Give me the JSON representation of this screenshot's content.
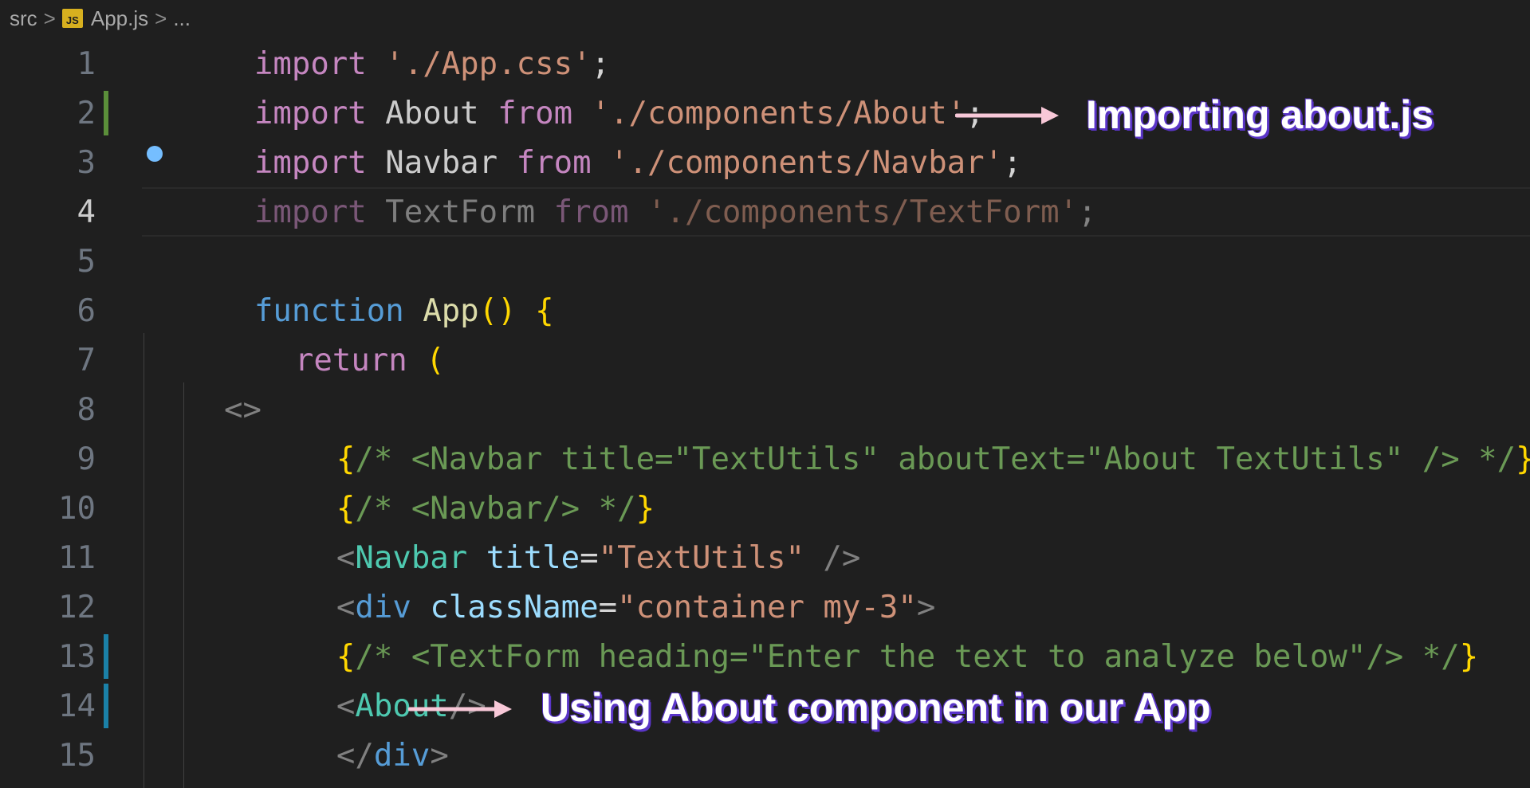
{
  "breadcrumb": {
    "folder": "src",
    "file": "App.js",
    "more": "...",
    "file_icon": "JS"
  },
  "lines": [
    {
      "n": "1"
    },
    {
      "n": "2"
    },
    {
      "n": "3"
    },
    {
      "n": "4"
    },
    {
      "n": "5"
    },
    {
      "n": "6"
    },
    {
      "n": "7"
    },
    {
      "n": "8"
    },
    {
      "n": "9"
    },
    {
      "n": "10"
    },
    {
      "n": "11"
    },
    {
      "n": "12"
    },
    {
      "n": "13"
    },
    {
      "n": "14"
    },
    {
      "n": "15"
    }
  ],
  "code": {
    "l1": {
      "kw": "import",
      "str": "'./App.css'",
      "end": ";"
    },
    "l2": {
      "kw": "import",
      "id": "About",
      "from": "from",
      "str": "'./components/About'",
      "end": ";"
    },
    "l3": {
      "kw": "import",
      "id": "Navbar",
      "from": "from",
      "str": "'./components/Navbar'",
      "end": ";"
    },
    "l4": {
      "kw": "import",
      "id": "TextForm",
      "from": "from",
      "str": "'./components/TextForm'",
      "end": ";"
    },
    "l6": {
      "kw": "function",
      "fn": "App",
      "paren": "()",
      "brace": "{"
    },
    "l7": {
      "kw": "return",
      "paren": "("
    },
    "l8": {
      "frag": "<>"
    },
    "l9": {
      "open": "{",
      "comment": "/* <Navbar title=\"TextUtils\" aboutText=\"About TextUtils\" /> */",
      "close": "}"
    },
    "l10": {
      "open": "{",
      "comment": "/* <Navbar/> */",
      "close": "}"
    },
    "l11": {
      "lt": "<",
      "tag": "Navbar",
      "attr": "title",
      "eq": "=",
      "val": "\"TextUtils\"",
      "end": " />"
    },
    "l12": {
      "lt": "<",
      "tag": "div",
      "attr": "className",
      "eq": "=",
      "val": "\"container my-3\"",
      "end": ">"
    },
    "l13": {
      "open": "{",
      "comment": "/* <TextForm heading=\"Enter the text to analyze below\"/> */",
      "close": "}"
    },
    "l14": {
      "lt": "<",
      "tag": "About",
      "end": "/>"
    },
    "l15": {
      "lt": "</",
      "tag": "div",
      "end": ">"
    }
  },
  "annotations": {
    "import_note": "Importing about.js",
    "usage_note": "Using About component in our App"
  },
  "colors": {
    "keyword": "#569cd6",
    "string": "#ce9178",
    "comment": "#6a9955",
    "tag": "#4ec9b0",
    "attribute": "#9cdcfe",
    "arrow": "#f8c8d8",
    "annotation_shadow": "#5a35c8"
  }
}
